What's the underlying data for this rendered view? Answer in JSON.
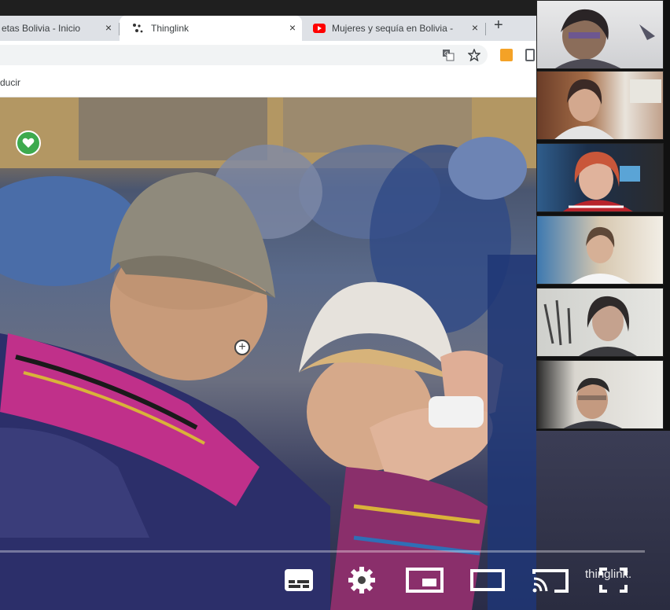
{
  "browser": {
    "tabs": [
      {
        "title": "etas Bolivia - Inicio",
        "favicon": "none",
        "active": false
      },
      {
        "title": "Thinglink",
        "favicon": "thinglink-dots-icon",
        "active": true
      },
      {
        "title": "Mujeres y sequía en Bolivia - ",
        "favicon": "youtube-icon",
        "active": false
      }
    ],
    "new_tab_symbol": "+",
    "close_symbol": "×",
    "bookmark_bar_label": "ducir",
    "extension_colors": {
      "orange": "#f4a227",
      "gray": "#5f6368"
    }
  },
  "thinglink": {
    "watermark": "thinglink.",
    "like_icon_color": "#3daa4e",
    "hotspot_symbol": "+"
  },
  "video_controls": [
    "subtitles-icon",
    "settings-icon",
    "miniplayer-icon",
    "theater-icon",
    "cast-icon",
    "fullscreen-icon"
  ],
  "participants": [
    {
      "name": "participant-1"
    },
    {
      "name": "participant-2"
    },
    {
      "name": "participant-3"
    },
    {
      "name": "participant-4"
    },
    {
      "name": "participant-5"
    },
    {
      "name": "participant-6"
    }
  ]
}
